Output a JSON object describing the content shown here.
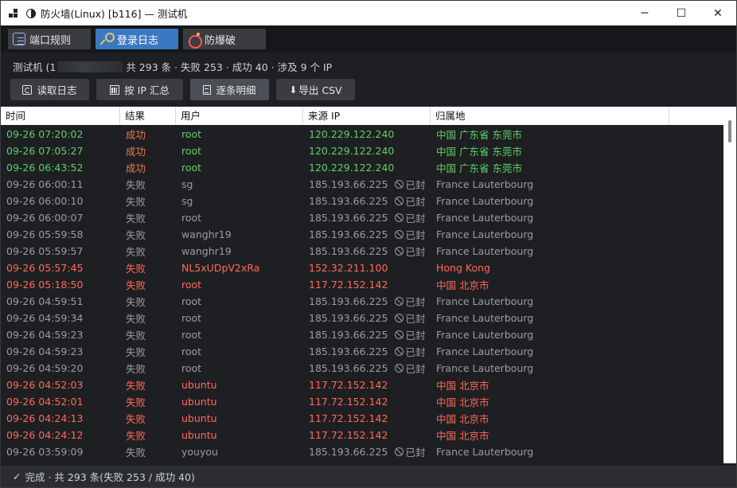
{
  "window": {
    "title": "防火墙(Linux) [b116] — 测试机",
    "minimize_glyph": "─",
    "maximize_glyph": "☐",
    "close_glyph": "✕"
  },
  "tabs": [
    {
      "label": "端口规则",
      "icon": "notebook-icon",
      "active": false
    },
    {
      "label": "登录日志",
      "icon": "key-icon",
      "active": true
    },
    {
      "label": "防爆破",
      "icon": "bomb-icon",
      "active": false
    }
  ],
  "info": {
    "host_prefix": "测试机 (1",
    "summary": "共 293 条 · 失败 253 · 成功 40 · 涉及 9 个 IP"
  },
  "toolbar": {
    "read_log": "读取日志",
    "group_by_ip": "按 IP 汇总",
    "detail": "逐条明细",
    "export_csv": "导出 CSV",
    "export_glyph": "⬇"
  },
  "table": {
    "headers": [
      "时间",
      "结果",
      "用户",
      "来源 IP",
      "归属地"
    ],
    "banned_label": "已封",
    "rows": [
      {
        "time": "09-26 07:20:02",
        "result": "成功",
        "user": "root",
        "ip": "120.229.122.240",
        "banned": false,
        "loc": "中国 广东省 东莞市",
        "style": "success"
      },
      {
        "time": "09-26 07:05:27",
        "result": "成功",
        "user": "root",
        "ip": "120.229.122.240",
        "banned": false,
        "loc": "中国 广东省 东莞市",
        "style": "success"
      },
      {
        "time": "09-26 06:43:52",
        "result": "成功",
        "user": "root",
        "ip": "120.229.122.240",
        "banned": false,
        "loc": "中国 广东省 东莞市",
        "style": "success"
      },
      {
        "time": "09-26 06:00:11",
        "result": "失败",
        "user": "sg",
        "ip": "185.193.66.225",
        "banned": true,
        "loc": "France Lauterbourg",
        "style": "fail"
      },
      {
        "time": "09-26 06:00:10",
        "result": "失败",
        "user": "sg",
        "ip": "185.193.66.225",
        "banned": true,
        "loc": "France Lauterbourg",
        "style": "fail"
      },
      {
        "time": "09-26 06:00:07",
        "result": "失败",
        "user": "root",
        "ip": "185.193.66.225",
        "banned": true,
        "loc": "France Lauterbourg",
        "style": "fail"
      },
      {
        "time": "09-26 05:59:58",
        "result": "失败",
        "user": "wanghr19",
        "ip": "185.193.66.225",
        "banned": true,
        "loc": "France Lauterbourg",
        "style": "fail"
      },
      {
        "time": "09-26 05:59:57",
        "result": "失败",
        "user": "wanghr19",
        "ip": "185.193.66.225",
        "banned": true,
        "loc": "France Lauterbourg",
        "style": "fail"
      },
      {
        "time": "09-26 05:57:45",
        "result": "失败",
        "user": "NL5xUDpV2xRa",
        "ip": "152.32.211.100",
        "banned": false,
        "loc": "Hong Kong",
        "style": "danger"
      },
      {
        "time": "09-26 05:18:50",
        "result": "失败",
        "user": "root",
        "ip": "117.72.152.142",
        "banned": false,
        "loc": "中国 北京市",
        "style": "danger"
      },
      {
        "time": "09-26 04:59:51",
        "result": "失败",
        "user": "root",
        "ip": "185.193.66.225",
        "banned": true,
        "loc": "France Lauterbourg",
        "style": "fail"
      },
      {
        "time": "09-26 04:59:34",
        "result": "失败",
        "user": "root",
        "ip": "185.193.66.225",
        "banned": true,
        "loc": "France Lauterbourg",
        "style": "fail"
      },
      {
        "time": "09-26 04:59:23",
        "result": "失败",
        "user": "root",
        "ip": "185.193.66.225",
        "banned": true,
        "loc": "France Lauterbourg",
        "style": "fail"
      },
      {
        "time": "09-26 04:59:23",
        "result": "失败",
        "user": "root",
        "ip": "185.193.66.225",
        "banned": true,
        "loc": "France Lauterbourg",
        "style": "fail"
      },
      {
        "time": "09-26 04:59:20",
        "result": "失败",
        "user": "root",
        "ip": "185.193.66.225",
        "banned": true,
        "loc": "France Lauterbourg",
        "style": "fail"
      },
      {
        "time": "09-26 04:52:03",
        "result": "失败",
        "user": "ubuntu",
        "ip": "117.72.152.142",
        "banned": false,
        "loc": "中国 北京市",
        "style": "danger"
      },
      {
        "time": "09-26 04:52:01",
        "result": "失败",
        "user": "ubuntu",
        "ip": "117.72.152.142",
        "banned": false,
        "loc": "中国 北京市",
        "style": "danger"
      },
      {
        "time": "09-26 04:24:13",
        "result": "失败",
        "user": "ubuntu",
        "ip": "117.72.152.142",
        "banned": false,
        "loc": "中国 北京市",
        "style": "danger"
      },
      {
        "time": "09-26 04:24:12",
        "result": "失败",
        "user": "ubuntu",
        "ip": "117.72.152.142",
        "banned": false,
        "loc": "中国 北京市",
        "style": "danger"
      },
      {
        "time": "09-26 03:59:09",
        "result": "失败",
        "user": "youyou",
        "ip": "185.193.66.225",
        "banned": true,
        "loc": "France Lauterbourg",
        "style": "fail"
      }
    ]
  },
  "status": {
    "check_glyph": "✓",
    "text": "完成 · 共 293 条(失败 253 / 成功 40)"
  },
  "colors": {
    "success": "#5fd06a",
    "success_result": "#e87a4c",
    "fail": "#9a9da3",
    "danger": "#ff6b5a",
    "active_tab": "#3b78c2"
  }
}
